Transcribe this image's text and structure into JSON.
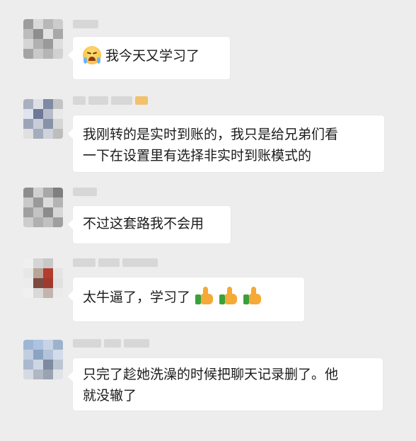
{
  "chat": {
    "messages": [
      {
        "id": 1,
        "text": "我今天又学习了",
        "emoji_prefix": "crying-laughing-face",
        "emoji_suffix": null
      },
      {
        "id": 2,
        "lines": [
          "我刚转的是实时到账的，我只是给兄弟们看",
          "一下在设置里有选择非实时到账模式的"
        ]
      },
      {
        "id": 3,
        "text": "不过这套路我不会用"
      },
      {
        "id": 4,
        "text": "太牛逼了，学习了",
        "emoji_suffix": [
          "thumbs-up",
          "thumbs-up",
          "thumbs-up"
        ]
      },
      {
        "id": 5,
        "lines": [
          "只完了趁她洗澡的时候把聊天记录删了。他",
          "就没辙了"
        ]
      }
    ]
  },
  "colors": {
    "background": "#ededed",
    "bubble": "#ffffff",
    "text": "#1b1b1b"
  }
}
